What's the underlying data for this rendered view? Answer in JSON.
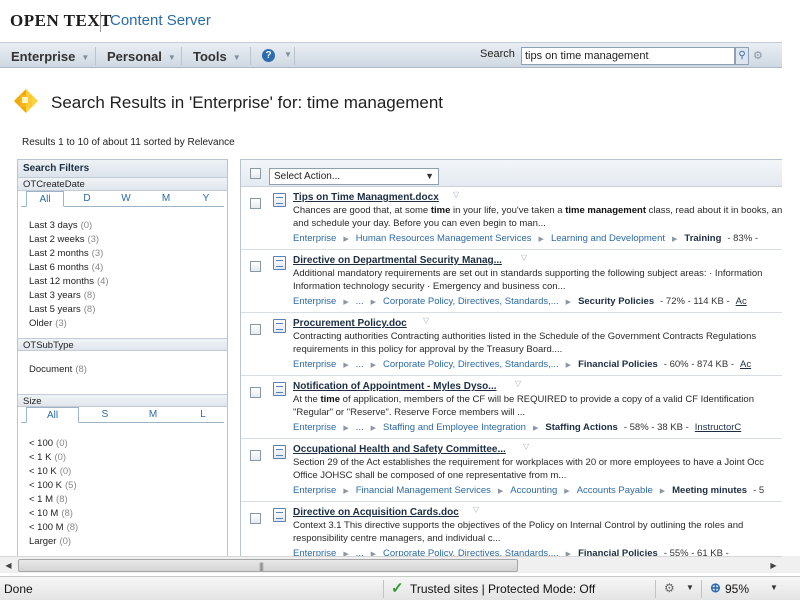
{
  "header": {
    "logo": "OPEN TEXT",
    "product": "Content Server"
  },
  "nav": {
    "items": [
      {
        "label": "Enterprise"
      },
      {
        "label": "Personal"
      },
      {
        "label": "Tools"
      }
    ],
    "help_glyph": "?",
    "search_label": "Search",
    "search_value": "tips on time management"
  },
  "page": {
    "title": "Search Results in 'Enterprise' for: time management",
    "summary": "Results 1 to 10 of about 11 sorted by Relevance"
  },
  "filters": {
    "title": "Search Filters",
    "create_date": {
      "title": "OTCreateDate",
      "tabs": [
        "All",
        "D",
        "W",
        "M",
        "Y"
      ],
      "active_tab": "All",
      "items": [
        {
          "label": "Last 3 days",
          "count": "(0)"
        },
        {
          "label": "Last 2 weeks",
          "count": "(3)"
        },
        {
          "label": "Last 2 months",
          "count": "(3)"
        },
        {
          "label": "Last 6 months",
          "count": "(4)"
        },
        {
          "label": "Last 12 months",
          "count": "(4)"
        },
        {
          "label": "Last 3 years",
          "count": "(8)"
        },
        {
          "label": "Last 5 years",
          "count": "(8)"
        },
        {
          "label": "Older",
          "count": "(3)"
        }
      ]
    },
    "subtype": {
      "title": "OTSubType",
      "items": [
        {
          "label": "Document",
          "count": "(8)"
        }
      ]
    },
    "size": {
      "title": "Size",
      "tabs": [
        "All",
        "S",
        "M",
        "L"
      ],
      "active_tab": "All",
      "items": [
        {
          "label": "< 100",
          "count": "(0)"
        },
        {
          "label": "< 1 K",
          "count": "(0)"
        },
        {
          "label": "< 10 K",
          "count": "(0)"
        },
        {
          "label": "< 100 K",
          "count": "(5)"
        },
        {
          "label": "< 1 M",
          "count": "(8)"
        },
        {
          "label": "< 10 M",
          "count": "(8)"
        },
        {
          "label": "< 100 M",
          "count": "(8)"
        },
        {
          "label": "Larger",
          "count": "(0)"
        }
      ]
    }
  },
  "results": {
    "select_action": "Select Action...",
    "items": [
      {
        "title": "Tips on Time Managment.docx",
        "snippet_html": "Chances are good that, at some <b>time</b> in your life, you've taken a <b>time management</b> class, read about it in books, and<br>and schedule your day. Before you can even begin to man...",
        "crumbs": [
          "Enterprise",
          "Human Resources Management Services",
          "Learning and Development"
        ],
        "last": "Training",
        "meta": "- 83% -"
      },
      {
        "title": "Directive on Departmental Security Manag...",
        "snippet_html": "Additional mandatory requirements are set out in standards supporting the following subject areas: · Information<br>Information technology security · Emergency and business con...",
        "crumbs": [
          "Enterprise",
          "...",
          "Corporate Policy, Directives, Standards,..."
        ],
        "last": "Security Policies",
        "meta": "- 72% - 114 KB -",
        "link": "Ac"
      },
      {
        "title": "Procurement Policy.doc",
        "snippet_html": "Contracting authorities Contracting authorities listed in the Schedule of the Government Contracts Regulations<br>requirements in this policy for approval by the Treasury Board....",
        "crumbs": [
          "Enterprise",
          "...",
          "Corporate Policy, Directives, Standards,..."
        ],
        "last": "Financial Policies",
        "meta": "- 60% - 874 KB -",
        "link": "Ac"
      },
      {
        "title": "Notification of Appointment - Myles Dyso...",
        "snippet_html": "At the <b>time</b> of application, members of the CF will be REQUIRED to provide a copy of a valid CF Identification<br>\"Regular\" or \"Reserve\". Reserve Force members will ...",
        "crumbs": [
          "Enterprise",
          "...",
          "Staffing and Employee Integration"
        ],
        "last": "Staffing Actions",
        "meta": "- 58% - 38 KB -",
        "link": "InstructorC"
      },
      {
        "title": "Occupational Health and Safety Committee...",
        "snippet_html": "Section 29 of the Act establishes the requirement for workplaces with 20 or more employees to have a Joint Occ<br>Office JOHSC shall be composed of one representative from m...",
        "crumbs": [
          "Enterprise",
          "Financial Management Services",
          "Accounting",
          "Accounts Payable"
        ],
        "last": "Meeting minutes",
        "meta": "- 5"
      },
      {
        "title": "Directive on Acquisition Cards.doc",
        "snippet_html": "Context 3.1 This directive supports the objectives of the Policy on Internal Control by outlining the roles and<br>responsibility centre managers, and individual c...",
        "crumbs": [
          "Enterprise",
          "...",
          "Corporate Policy, Directives, Standards,..."
        ],
        "last": "Financial Policies",
        "meta": "- 55% - 61 KB -"
      }
    ]
  },
  "statusbar": {
    "status": "Done",
    "zone": "Trusted sites | Protected Mode: Off",
    "zoom": "95%"
  },
  "icons": {
    "nav_caret": "chevron-down-icon",
    "title": "search-results-icon",
    "document": "word-document-icon",
    "trusted": "check-icon",
    "zoom": "zoom-icon"
  },
  "colors": {
    "link_blue": "#2d6aa3",
    "nav_bg": "#d7e0e9",
    "trusted_green": "#2e9a2e"
  }
}
